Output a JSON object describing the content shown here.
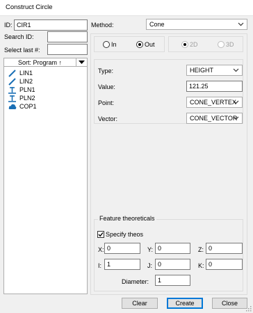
{
  "window": {
    "title": "Construct Circle"
  },
  "left": {
    "id_label": "ID:",
    "id_value": "CIR1",
    "search_label": "Search ID:",
    "search_value": "",
    "select_last_label": "Select last #:",
    "select_last_value": "",
    "sort_label": "Sort: Program ↑",
    "features": [
      {
        "label": "LIN1",
        "icon": "line-icon"
      },
      {
        "label": "LIN2",
        "icon": "line-icon"
      },
      {
        "label": "PLN1",
        "icon": "plane-icon"
      },
      {
        "label": "PLN2",
        "icon": "plane-icon"
      },
      {
        "label": "COP1",
        "icon": "point-cloud-icon"
      }
    ]
  },
  "method": {
    "label": "Method:",
    "value": "Cone"
  },
  "options": {
    "in": "In",
    "out": "Out",
    "two_d": "2D",
    "three_d": "3D",
    "selected": "Out"
  },
  "params": {
    "type_label": "Type:",
    "type_value": "HEIGHT",
    "value_label": "Value:",
    "value_value": "121.25",
    "point_label": "Point:",
    "point_value": "CONE_VERTEX",
    "vector_label": "Vector:",
    "vector_value": "CONE_VECTOR"
  },
  "theo": {
    "title": "Feature theoreticals",
    "specify_label": "Specify theos",
    "specify_checked": true,
    "x_label": "X:",
    "x": "0",
    "y_label": "Y:",
    "y": "0",
    "z_label": "Z:",
    "z": "0",
    "i_label": "I:",
    "i": "1",
    "j_label": "J:",
    "j": "0",
    "k_label": "K:",
    "k": "0",
    "diameter_label": "Diameter:",
    "diameter": "1"
  },
  "buttons": {
    "clear": "Clear",
    "create": "Create",
    "close": "Close"
  },
  "colors": {
    "accent": "#0078d7",
    "icon_blue": "#1a6fb5"
  }
}
